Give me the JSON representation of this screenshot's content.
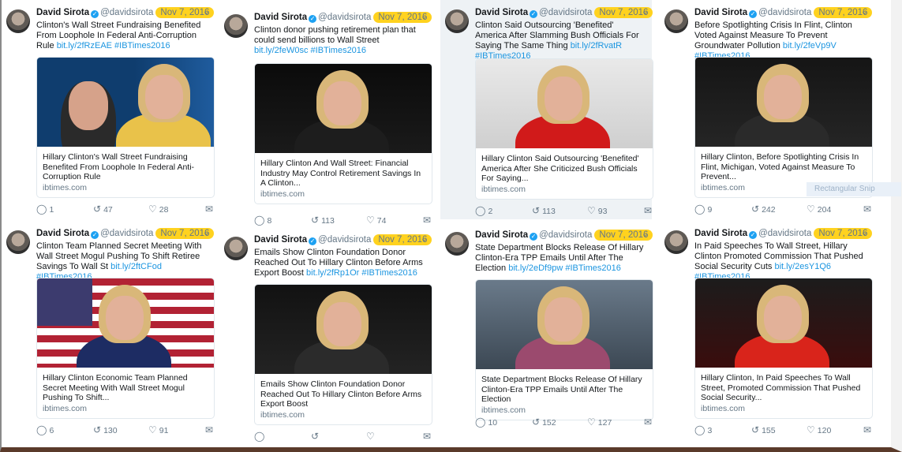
{
  "author": {
    "name": "David Sirota",
    "handle": "@davidsirota",
    "date": "Nov 7, 2016"
  },
  "tweets": [
    {
      "text": "Clinton's Wall Street Fundraising Benefited From Loophole In Federal Anti-Corruption Rule",
      "link": "bit.ly/2fRzEAE #IBTimes2016",
      "card_title": "Hillary Clinton's Wall Street Fundraising Benefited From Loophole In Federal Anti-Corruption Rule",
      "domain": "ibtimes.com",
      "replies": "1",
      "retweets": "47",
      "likes": "28"
    },
    {
      "text": "Clinton donor pushing retirement plan that could send billions to Wall Street",
      "link": "bit.ly/2feW0sc #IBTimes2016",
      "card_title": "Hillary Clinton And Wall Street: Financial Industry May Control Retirement Savings In A Clinton...",
      "domain": "ibtimes.com",
      "replies": "8",
      "retweets": "113",
      "likes": "74"
    },
    {
      "text": "Clinton Said Outsourcing 'Benefited' America After Slamming Bush Officials For Saying The Same Thing",
      "link": "bit.ly/2fRvatR #IBTimes2016",
      "card_title": "Hillary Clinton Said Outsourcing 'Benefited' America After She Criticized Bush Officials For Saying...",
      "domain": "ibtimes.com",
      "replies": "2",
      "retweets": "113",
      "likes": "93"
    },
    {
      "text": "Before Spotlighting Crisis In Flint, Clinton Voted Against Measure To Prevent Groundwater Pollution",
      "link": "bit.ly/2feVp9V #IBTimes2016",
      "card_title": "Hillary Clinton, Before Spotlighting Crisis In Flint, Michigan, Voted Against Measure To Prevent...",
      "domain": "ibtimes.com",
      "replies": "9",
      "retweets": "242",
      "likes": "204"
    },
    {
      "text": "Clinton Team Planned Secret Meeting With Wall Street Mogul Pushing To Shift Retiree Savings To Wall St",
      "link": "bit.ly/2ftCFod #IBTimes2016",
      "card_title": "Hillary Clinton Economic Team Planned Secret Meeting With Wall Street Mogul Pushing To Shift...",
      "domain": "ibtimes.com",
      "replies": "6",
      "retweets": "130",
      "likes": "91"
    },
    {
      "text": "Emails Show Clinton Foundation Donor Reached Out To Hillary Clinton Before Arms Export Boost",
      "link": "bit.ly/2fRp1Or #IBTimes2016",
      "card_title": "Emails Show Clinton Foundation Donor Reached Out To Hillary Clinton Before Arms Export Boost",
      "domain": "ibtimes.com",
      "replies": "",
      "retweets": "",
      "likes": ""
    },
    {
      "text": "State Department Blocks Release Of Hillary Clinton-Era TPP Emails Until After The Election",
      "link": "bit.ly/2eDf9pw #IBTimes2016",
      "card_title": "State Department Blocks Release Of Hillary Clinton-Era TPP Emails Until After The Election",
      "domain": "ibtimes.com",
      "replies": "10",
      "retweets": "152",
      "likes": "127"
    },
    {
      "text": "In Paid Speeches To Wall Street, Hillary Clinton Promoted Commission That Pushed Social Security Cuts",
      "link": "bit.ly/2esY1Q6 #IBTimes2016",
      "card_title": "Hillary Clinton, In Paid Speeches To Wall Street, Promoted Commission That Pushed Social Security...",
      "domain": "ibtimes.com",
      "replies": "3",
      "retweets": "155",
      "likes": "120"
    }
  ],
  "overlay": {
    "ghost_label": "Rectangular Snip"
  },
  "icons": {
    "reply": "reply-icon",
    "retweet": "retweet-icon",
    "like": "heart-icon",
    "dm": "envelope-icon",
    "verified": "verified-badge-icon",
    "menu": "chevron-down-icon"
  },
  "colors": {
    "link": "#1b95e0",
    "highlight": "#ffd21f",
    "verified": "#1da1f2"
  }
}
